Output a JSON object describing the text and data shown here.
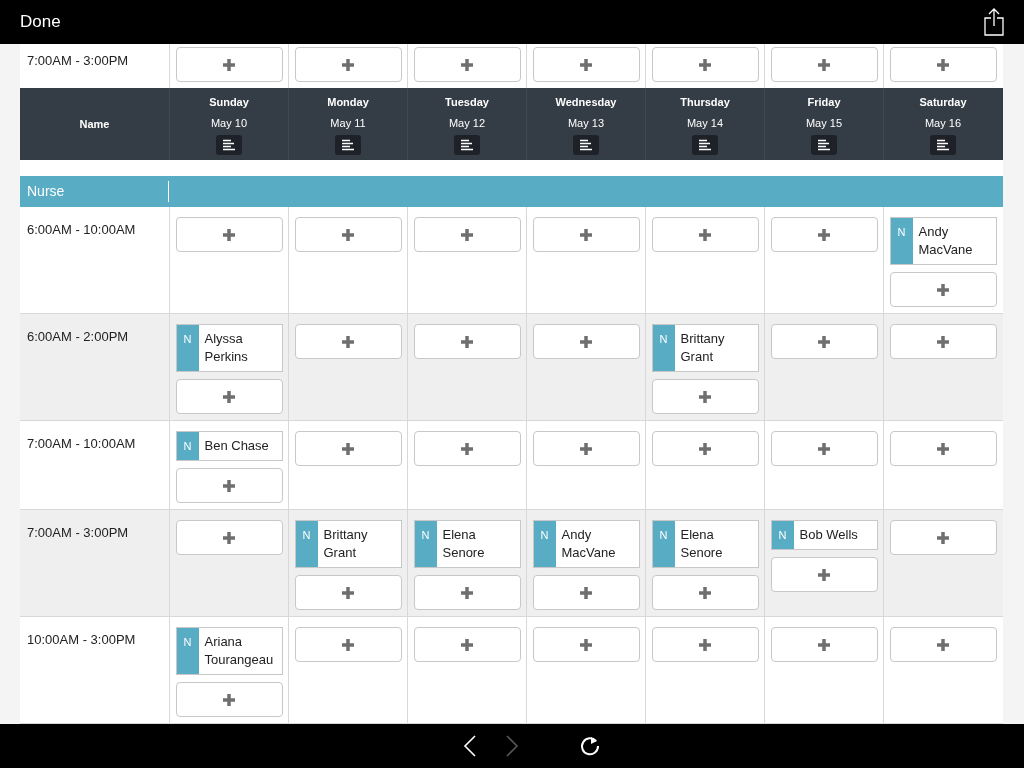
{
  "top_bar": {
    "done_label": "Done"
  },
  "previous_row": {
    "time": "7:00AM - 3:00PM",
    "cells": [
      {
        "kind": "open"
      },
      {
        "kind": "open"
      },
      {
        "kind": "open"
      },
      {
        "kind": "open"
      },
      {
        "kind": "open"
      },
      {
        "kind": "open"
      },
      {
        "kind": "open"
      }
    ]
  },
  "header": {
    "name_label": "Name",
    "days": [
      {
        "day": "Sunday",
        "date": "May 10"
      },
      {
        "day": "Monday",
        "date": "May 11"
      },
      {
        "day": "Tuesday",
        "date": "May 12"
      },
      {
        "day": "Wednesday",
        "date": "May 13"
      },
      {
        "day": "Thursday",
        "date": "May 14"
      },
      {
        "day": "Friday",
        "date": "May 15"
      },
      {
        "day": "Saturday",
        "date": "May 16"
      }
    ]
  },
  "group": {
    "title": "Nurse"
  },
  "rows": [
    {
      "time": "6:00AM - 10:00AM",
      "cells": [
        {
          "kind": "open"
        },
        {
          "kind": "open"
        },
        {
          "kind": "open"
        },
        {
          "kind": "open"
        },
        {
          "kind": "open"
        },
        {
          "kind": "open"
        },
        {
          "kind": "staffed",
          "shifts": [
            {
              "badge": "N",
              "name": "Andy MacVane"
            }
          ]
        }
      ]
    },
    {
      "time": "6:00AM - 2:00PM",
      "cells": [
        {
          "kind": "staffed",
          "shifts": [
            {
              "badge": "N",
              "name": "Alyssa Perkins"
            }
          ]
        },
        {
          "kind": "open"
        },
        {
          "kind": "open"
        },
        {
          "kind": "open"
        },
        {
          "kind": "staffed",
          "shifts": [
            {
              "badge": "N",
              "name": "Brittany Grant"
            }
          ]
        },
        {
          "kind": "open"
        },
        {
          "kind": "open"
        }
      ]
    },
    {
      "time": "7:00AM - 10:00AM",
      "cells": [
        {
          "kind": "staffed",
          "shifts": [
            {
              "badge": "N",
              "name": "Ben Chase"
            }
          ]
        },
        {
          "kind": "open"
        },
        {
          "kind": "open"
        },
        {
          "kind": "open"
        },
        {
          "kind": "open"
        },
        {
          "kind": "open"
        },
        {
          "kind": "open"
        }
      ]
    },
    {
      "time": "7:00AM - 3:00PM",
      "cells": [
        {
          "kind": "open"
        },
        {
          "kind": "staffed",
          "shifts": [
            {
              "badge": "N",
              "name": "Brittany Grant"
            }
          ]
        },
        {
          "kind": "staffed",
          "shifts": [
            {
              "badge": "N",
              "name": "Elena Senore"
            }
          ]
        },
        {
          "kind": "staffed",
          "shifts": [
            {
              "badge": "N",
              "name": "Andy MacVane"
            }
          ]
        },
        {
          "kind": "staffed",
          "shifts": [
            {
              "badge": "N",
              "name": "Elena Senore"
            }
          ]
        },
        {
          "kind": "staffed",
          "shifts": [
            {
              "badge": "N",
              "name": "Bob Wells"
            }
          ]
        },
        {
          "kind": "open"
        }
      ]
    },
    {
      "time": "10:00AM - 3:00PM",
      "cells": [
        {
          "kind": "staffed",
          "shifts": [
            {
              "badge": "N",
              "name": "Ariana Tourangeau"
            }
          ]
        },
        {
          "kind": "open"
        },
        {
          "kind": "open"
        },
        {
          "kind": "open"
        },
        {
          "kind": "open"
        },
        {
          "kind": "open"
        },
        {
          "kind": "open"
        }
      ]
    }
  ],
  "bottom_bar": {
    "back": {
      "disabled": false
    },
    "forward": {
      "disabled": true
    }
  }
}
